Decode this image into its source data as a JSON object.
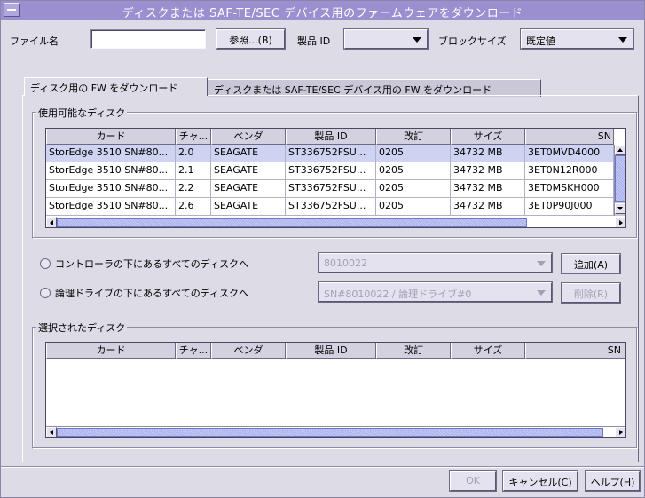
{
  "window": {
    "title": "ディスクまたは SAF-TE/SEC デバイス用のファームウェアをダウンロード"
  },
  "top": {
    "file_label": "ファイル名",
    "file_value": "",
    "browse_label": "参照...(B)",
    "product_id_label": "製品 ID",
    "product_id_value": "",
    "block_size_label": "ブロックサイズ",
    "block_size_value": "既定値"
  },
  "tabs": [
    {
      "label": "ディスク用の FW をダウンロード",
      "active": true
    },
    {
      "label": "ディスクまたは SAF-TE/SEC デバイス用の FW をダウンロード",
      "active": false
    }
  ],
  "available": {
    "title": "使用可能なディスク",
    "columns": [
      "カード",
      "チャ...",
      "ベンダ",
      "製品 ID",
      "改訂",
      "サイズ",
      "SN"
    ],
    "rows": [
      [
        "StorEdge 3510 SN#80...",
        "2.0",
        "SEAGATE",
        "ST336752FSU...",
        "0205",
        "34732 MB",
        "3ET0MVD4000"
      ],
      [
        "StorEdge 3510 SN#80...",
        "2.1",
        "SEAGATE",
        "ST336752FSU...",
        "0205",
        "34732 MB",
        "3ET0N12R000"
      ],
      [
        "StorEdge 3510 SN#80...",
        "2.2",
        "SEAGATE",
        "ST336752FSU...",
        "0205",
        "34732 MB",
        "3ET0MSKH000"
      ],
      [
        "StorEdge 3510 SN#80...",
        "2.6",
        "SEAGATE",
        "ST336752FSU...",
        "0205",
        "34732 MB",
        "3ET0P90J000"
      ]
    ],
    "selected_row": 0
  },
  "options": {
    "radio_controller_label": "コントローラの下にあるすべてのディスクへ",
    "controller_value": "8010022",
    "add_label": "追加(A)",
    "radio_logical_label": "論理ドライブの下にあるすべてのディスクへ",
    "logical_value": "SN#8010022 / 論理ドライブ#0",
    "remove_label": "削除(R)"
  },
  "selected": {
    "title": "選択されたディスク",
    "columns": [
      "カード",
      "チャ...",
      "ベンダ",
      "製品 ID",
      "改訂",
      "サイズ",
      "SN"
    ]
  },
  "footer": {
    "ok_label": "OK",
    "cancel_label": "キャンセル(C)",
    "help_label": "ヘルプ(H)"
  },
  "colors": {
    "title_bar": "#9c8fd0",
    "window_bg": "#dcdbe6",
    "selection": "#cfd3f2"
  }
}
